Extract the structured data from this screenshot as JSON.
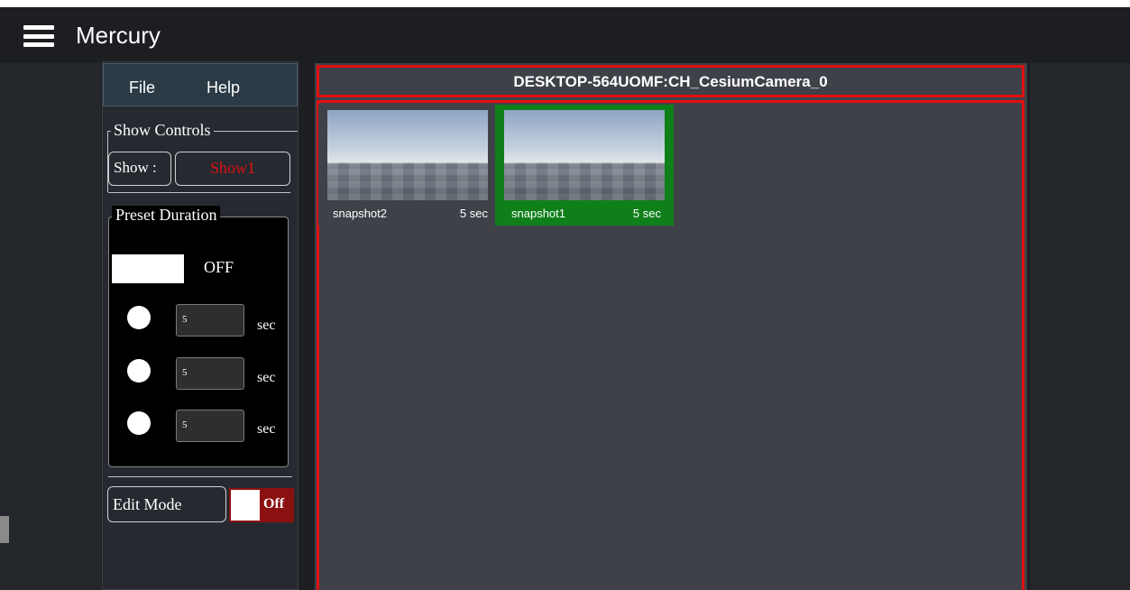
{
  "app": {
    "title": "Mercury"
  },
  "menu": {
    "file": "File",
    "help": "Help"
  },
  "show_controls": {
    "legend": "Show Controls",
    "show_label": "Show :",
    "show_value": "Show1"
  },
  "preset_duration": {
    "legend": "Preset Duration",
    "off_label": "OFF",
    "presets": [
      {
        "value": "5",
        "unit": "sec"
      },
      {
        "value": "5",
        "unit": "sec"
      },
      {
        "value": "5",
        "unit": "sec"
      }
    ]
  },
  "edit_mode": {
    "label": "Edit Mode",
    "toggle_text": "Off"
  },
  "camera": {
    "title": "DESKTOP-564UOMF:CH_CesiumCamera_0"
  },
  "snapshots": [
    {
      "name": "snapshot2",
      "duration": "5 sec",
      "selected": false
    },
    {
      "name": "snapshot1",
      "duration": "5 sec",
      "selected": true
    }
  ],
  "colors": {
    "accent_red": "#e01010",
    "selected_green": "#0f7f1a",
    "show_value_red": "#e01010",
    "toggle_off_red": "#8b1010"
  }
}
